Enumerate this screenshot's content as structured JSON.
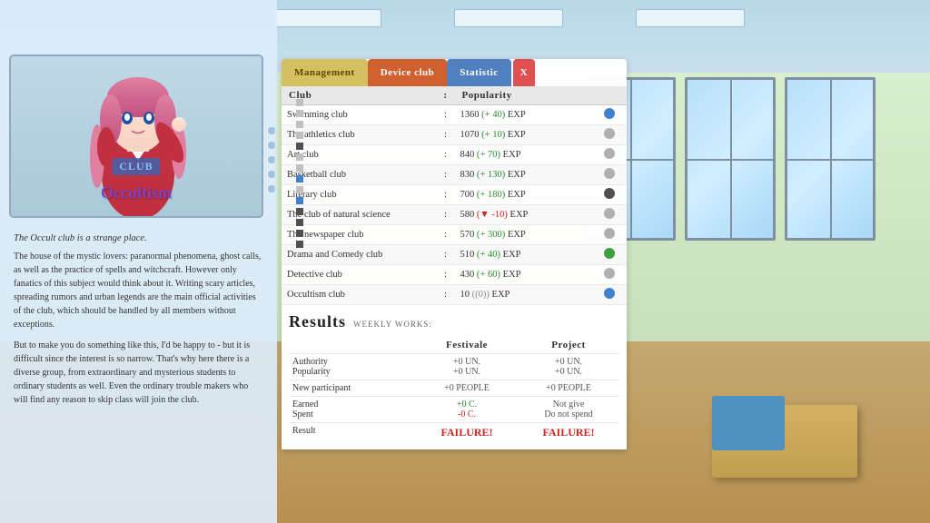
{
  "background": {
    "classroom": "anime classroom background"
  },
  "tabs": {
    "management": "Management",
    "device_club": "Device club",
    "statistic": "Statistic",
    "close": "X"
  },
  "table": {
    "headers": {
      "club": "Club",
      "separator": ":",
      "popularity": "Popularity",
      "action": ""
    },
    "rows": [
      {
        "club": "Swimming club",
        "sep": ":",
        "popularity": "1360",
        "change": "+ 40",
        "unit": "EXP",
        "change_type": "plus",
        "dot": "blue"
      },
      {
        "club": "The athletics club",
        "sep": ":",
        "popularity": "1070",
        "change": "+ 10",
        "unit": "EXP",
        "change_type": "plus",
        "dot": "grey"
      },
      {
        "club": "Art club",
        "sep": ":",
        "popularity": "840",
        "change": "+ 70",
        "unit": "EXP",
        "change_type": "plus",
        "dot": "grey"
      },
      {
        "club": "Basketball club",
        "sep": ":",
        "popularity": "830",
        "change": "+ 130",
        "unit": "EXP",
        "change_type": "plus",
        "dot": "grey"
      },
      {
        "club": "Literary club",
        "sep": ":",
        "popularity": "700",
        "change": "+ 180",
        "unit": "EXP",
        "change_type": "plus",
        "dot": "dark"
      },
      {
        "club": "The club of natural science",
        "sep": ":",
        "popularity": "580",
        "change": "▼ -10",
        "unit": "EXP",
        "change_type": "minus",
        "dot": "grey"
      },
      {
        "club": "The newspaper club",
        "sep": ":",
        "popularity": "570",
        "change": "+ 300",
        "unit": "EXP",
        "change_type": "plus",
        "dot": "grey"
      },
      {
        "club": "Drama and Comedy club",
        "sep": ":",
        "popularity": "510",
        "change": "+ 40",
        "unit": "EXP",
        "change_type": "plus",
        "dot": "green"
      },
      {
        "club": "Detective club",
        "sep": ":",
        "popularity": "430",
        "change": "+ 60",
        "unit": "EXP",
        "change_type": "plus",
        "dot": "grey"
      },
      {
        "club": "Occultism club",
        "sep": ":",
        "popularity": "10",
        "change": "(0)",
        "unit": "EXP",
        "change_type": "neutral",
        "dot": "blue"
      }
    ]
  },
  "results": {
    "title": "Results",
    "subtitle": "Weekly works:",
    "headers": [
      "Festivale",
      "Project"
    ],
    "rows": [
      {
        "label": "Authority\nPopularity",
        "festivale": "+0 UN.\n+0 UN.",
        "project": "+0 UN.\n+0 UN.",
        "festivale_class": "val-neutral",
        "project_class": "val-neutral"
      },
      {
        "label": "New participant",
        "festivale": "+0 PEOPLE",
        "project": "+0 PEOPLE",
        "festivale_class": "val-neutral",
        "project_class": "val-neutral"
      },
      {
        "label": "Earned\nSpent",
        "festivale": "+0 C.\n-0 C.",
        "project": "Not give\nDo not spend",
        "festivale_class": "val-green",
        "project_class": "val-neutral"
      },
      {
        "label": "Result",
        "festivale": "FAILURE!",
        "project": "FAILURE!",
        "festivale_class": "val-red",
        "project_class": "val-red"
      }
    ]
  },
  "left_panel": {
    "club_label": "CLUB",
    "title": "Occultism",
    "description_1": "The Occult club is a strange place.",
    "description_2": "The house of the mystic lovers: paranormal phenomena, ghost calls, as well as the practice of spells and witchcraft. However only fanatics of this subject would think about it. Writing scary articles, spreading rumors and urban legends are the main official activities of the club, which should be handled by all members without exceptions.",
    "description_3": "But to make you do something like this, I'd be happy to - but it is difficult since the interest is so narrow. That's why here there is a diverse group, from extraordinary and mysterious students to ordinary students as well. Even the ordinary trouble makers who will find any reason to skip class will join the club."
  },
  "colors": {
    "tab_management": "#d4c060",
    "tab_device": "#d06030",
    "tab_statistic": "#5080c0",
    "tab_close": "#e05050",
    "plus": "#2a8a2a",
    "minus": "#cc2222",
    "failure": "#cc2222",
    "occultism_title": "#8040c0"
  }
}
